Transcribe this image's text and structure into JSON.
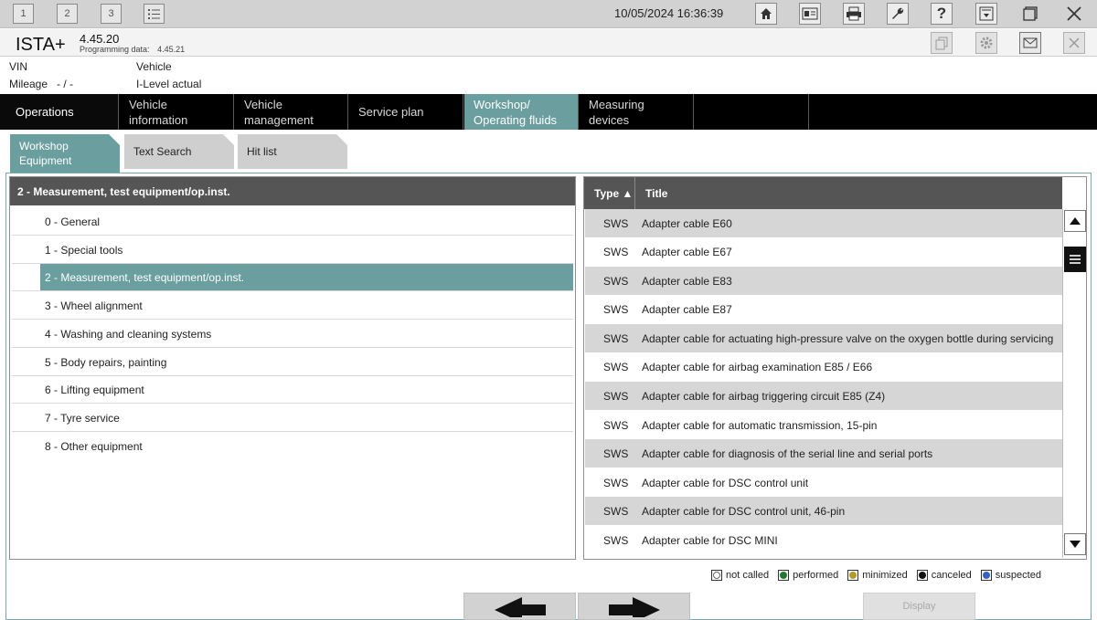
{
  "window": {
    "screen_buttons": [
      "1",
      "2",
      "3"
    ],
    "datetime": "10/05/2024 16:36:39"
  },
  "app": {
    "name": "ISTA+",
    "version": "4.45.20",
    "programming_label": "Programming data:",
    "programming_value": "4.45.21"
  },
  "vehicle_info": {
    "vin_label": "VIN",
    "vehicle_label": "Vehicle",
    "mileage_label": "Mileage",
    "mileage_value": "- / -",
    "ilevel_label": "I-Level actual"
  },
  "main_nav": {
    "tabs": [
      {
        "label": "Operations"
      },
      {
        "label": "Vehicle information"
      },
      {
        "label": "Vehicle\nmanagement"
      },
      {
        "label": "Service plan"
      },
      {
        "label": "Workshop/\nOperating fluids"
      },
      {
        "label": "Measuring devices"
      }
    ],
    "active_index": 4
  },
  "sub_tabs": {
    "tabs": [
      {
        "label": "Workshop\nEquipment"
      },
      {
        "label": "Text Search"
      },
      {
        "label": "Hit list"
      }
    ],
    "active_index": 0
  },
  "left_panel": {
    "header": "2 - Measurement, test equipment/op.inst.",
    "items": [
      "0 - General",
      "1 - Special tools",
      "2 - Measurement, test equipment/op.inst.",
      "3 - Wheel alignment",
      "4 - Washing and cleaning systems",
      "5 - Body repairs, painting",
      "6 - Lifting equipment",
      "7 - Tyre service",
      "8 - Other equipment"
    ],
    "selected_index": 2
  },
  "right_panel": {
    "columns": {
      "type": "Type ▲",
      "title": "Title"
    },
    "rows": [
      {
        "type": "SWS",
        "title": "Adapter cable E60"
      },
      {
        "type": "SWS",
        "title": "Adapter cable E67"
      },
      {
        "type": "SWS",
        "title": "Adapter cable E83"
      },
      {
        "type": "SWS",
        "title": "Adapter cable E87"
      },
      {
        "type": "SWS",
        "title": "Adapter cable for actuating high-pressure valve on the oxygen bottle during servicing"
      },
      {
        "type": "SWS",
        "title": "Adapter cable for airbag examination E85 / E66"
      },
      {
        "type": "SWS",
        "title": "Adapter cable for airbag triggering circuit E85 (Z4)"
      },
      {
        "type": "SWS",
        "title": "Adapter cable for automatic transmission, 15-pin"
      },
      {
        "type": "SWS",
        "title": "Adapter cable for diagnosis of the serial line and serial ports"
      },
      {
        "type": "SWS",
        "title": "Adapter cable for DSC control unit"
      },
      {
        "type": "SWS",
        "title": "Adapter cable for DSC control unit, 46-pin"
      },
      {
        "type": "SWS",
        "title": "Adapter cable for DSC MINI"
      }
    ]
  },
  "legend": [
    {
      "label": "not called",
      "color": "#ffffff"
    },
    {
      "label": "performed",
      "color": "#1f7a2e"
    },
    {
      "label": "minimized",
      "color": "#b8982a"
    },
    {
      "label": "canceled",
      "color": "#111111"
    },
    {
      "label": "suspected",
      "color": "#3a5fc8"
    }
  ],
  "bottom": {
    "display_label": "Display"
  },
  "colors": {
    "accent": "#6b9e9e",
    "nav_bg": "#000000",
    "header_gray": "#555555"
  }
}
